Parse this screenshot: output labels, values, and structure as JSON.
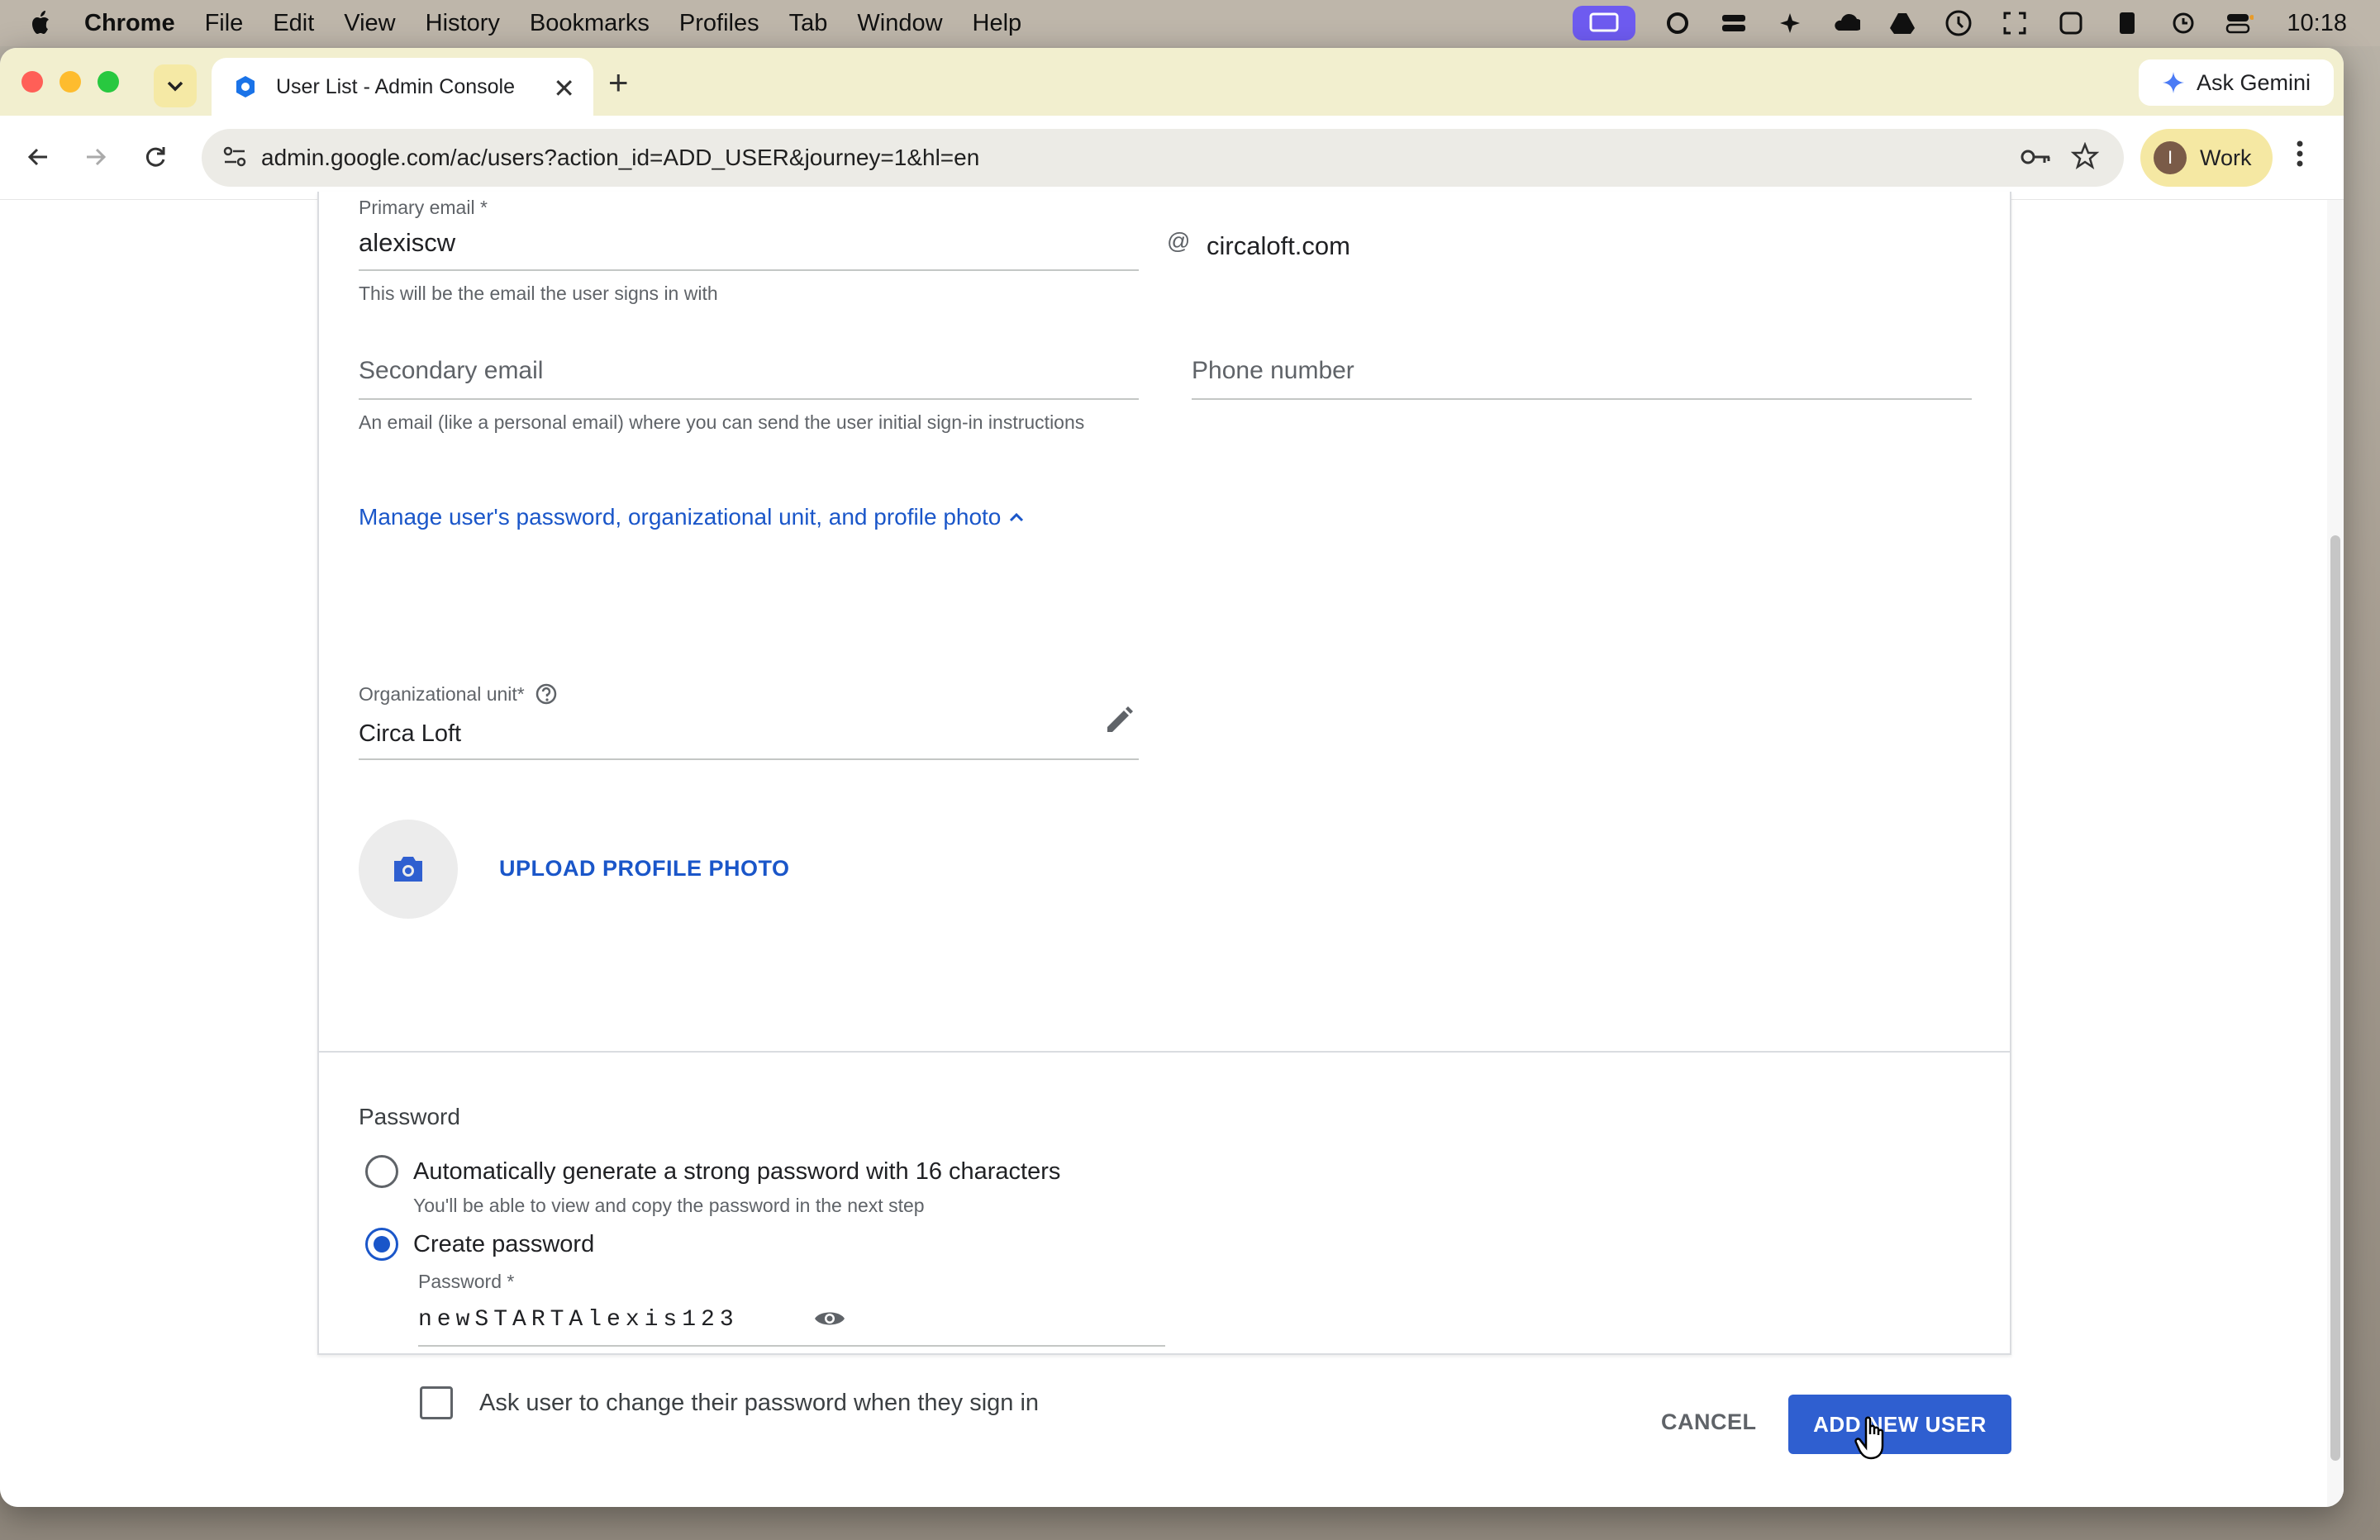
{
  "menubar": {
    "app": "Chrome",
    "items": [
      "File",
      "Edit",
      "View",
      "History",
      "Bookmarks",
      "Profiles",
      "Tab",
      "Window",
      "Help"
    ],
    "clock": "10:18"
  },
  "browser": {
    "tab_title": "User List - Admin Console",
    "url": "admin.google.com/ac/users?action_id=ADD_USER&journey=1&hl=en",
    "ask_gemini": "Ask Gemini",
    "profile_initial": "I",
    "profile_name": "Work"
  },
  "form": {
    "primary_email_label": "Primary email *",
    "primary_email_value": "alexiscw",
    "at_sign": "@",
    "domain": "circaloft.com",
    "primary_email_helper": "This will be the email the user signs in with",
    "secondary_email_placeholder": "Secondary email",
    "secondary_email_helper": "An email (like a personal email) where you can send the user initial sign-in instructions",
    "phone_placeholder": "Phone number",
    "manage_link": "Manage user's password, organizational unit, and profile photo",
    "org_unit_label": "Organizational unit*",
    "org_unit_value": "Circa Loft",
    "upload_photo": "UPLOAD PROFILE PHOTO",
    "password_section_title": "Password",
    "auto_option_label": "Automatically generate a strong password with 16 characters",
    "auto_option_helper": "You'll be able to view and copy the password in the next step",
    "create_option_label": "Create password",
    "password_label": "Password *",
    "password_value": "newSTARTAlexis123",
    "ask_change_label": "Ask user to change their password when they sign in",
    "selected_option": "create"
  },
  "actions": {
    "cancel": "CANCEL",
    "add_user": "ADD NEW USER"
  },
  "colors": {
    "accent": "#1a56c9",
    "primary_button": "#2f5fd0"
  }
}
